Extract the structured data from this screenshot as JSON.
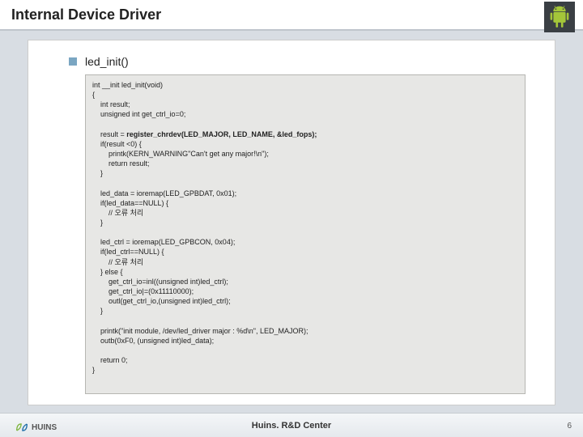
{
  "header": {
    "title": "Internal Device Driver"
  },
  "section": {
    "func_name": "led_init()"
  },
  "code": {
    "l1": "int __init led_init(void)",
    "l2": "{",
    "l3": "    int result;",
    "l4": "    unsigned int get_ctrl_io=0;",
    "l5": "",
    "l6a": "    result = ",
    "l6b": "register_chrdev(LED_MAJOR, LED_NAME, &led_fops);",
    "l7": "    if(result <0) {",
    "l8": "        printk(KERN_WARNING\"Can't get any major!\\n\");",
    "l9": "        return result;",
    "l10": "    }",
    "l11": "",
    "l12": "    led_data = ioremap(LED_GPBDAT, 0x01);",
    "l13": "    if(led_data==NULL) {",
    "l14": "        // 오류 처리",
    "l15": "    }",
    "l16": "",
    "l17": "    led_ctrl = ioremap(LED_GPBCON, 0x04);",
    "l18": "    if(led_ctrl==NULL) {",
    "l19": "        // 오류 처리",
    "l20": "    } else {",
    "l21": "        get_ctrl_io=inl((unsigned int)led_ctrl);",
    "l22": "        get_ctrl_io|=(0x11110000);",
    "l23": "        outl(get_ctrl_io,(unsigned int)led_ctrl);",
    "l24": "    }",
    "l25": "",
    "l26": "    printk(\"init module, /dev/led_driver major : %d\\n\", LED_MAJOR);",
    "l27": "    outb(0xF0, (unsigned int)led_data);",
    "l28": "",
    "l29": "    return 0;",
    "l30": "}"
  },
  "footer": {
    "center": "Huins. R&D Center",
    "logo_text": "HUINS",
    "page_number": "6"
  }
}
